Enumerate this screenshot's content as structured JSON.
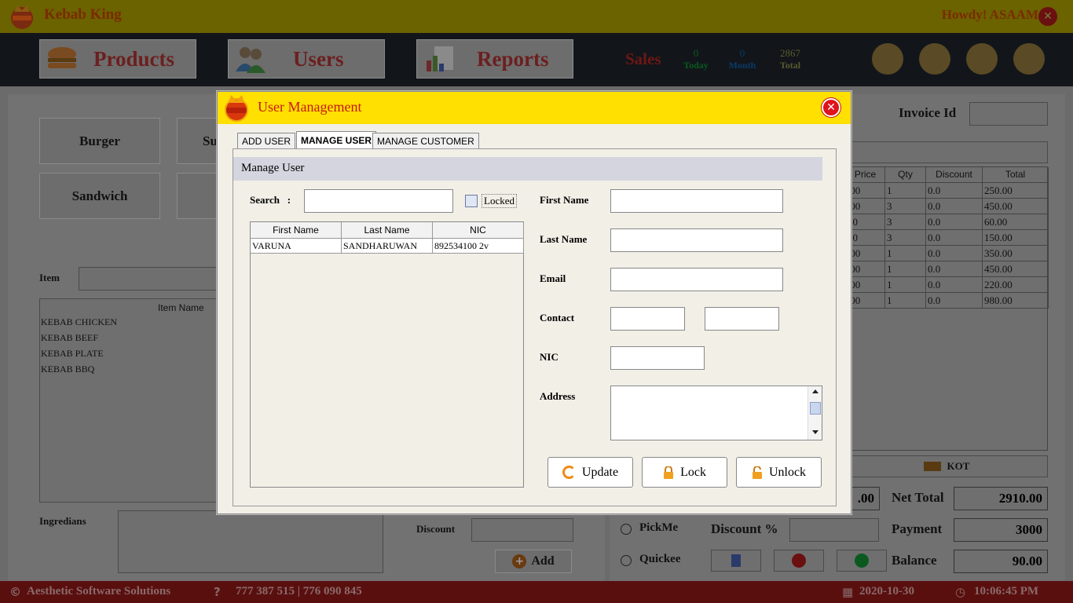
{
  "app": {
    "title": "Kebab King",
    "greeting": "Howdy! ASAAM"
  },
  "nav": {
    "products": "Products",
    "users": "Users",
    "reports": "Reports",
    "sales_label": "Sales",
    "stats": [
      {
        "value": "0",
        "label": "Today"
      },
      {
        "value": "0",
        "label": "Month"
      },
      {
        "value": "2867",
        "label": "Total"
      }
    ]
  },
  "categories": [
    "Burger",
    "Su",
    "Sandwich"
  ],
  "item_search": {
    "label": "Item",
    "value": ""
  },
  "item_table": {
    "header": "Item Name",
    "rows": [
      "KEBAB CHICKEN",
      "KEBAB BEEF",
      "KEBAB PLATE",
      "KEBAB BBQ"
    ]
  },
  "ingredients_label": "Ingredians",
  "discount_label": "Discount",
  "add_button": "Add",
  "invoice": {
    "label": "Invoice Id",
    "columns": [
      "Price",
      "Qty",
      "Discount",
      "Total"
    ],
    "rows": [
      [
        ".00",
        "1",
        "0.0",
        "250.00"
      ],
      [
        ".00",
        "3",
        "0.0",
        "450.00"
      ],
      [
        "00",
        "3",
        "0.0",
        "60.00"
      ],
      [
        "00",
        "3",
        "0.0",
        "150.00"
      ],
      [
        ".00",
        "1",
        "0.0",
        "350.00"
      ],
      [
        ".00",
        "1",
        "0.0",
        "450.00"
      ],
      [
        ".00",
        "1",
        "0.0",
        "220.00"
      ],
      [
        ".00",
        "1",
        "0.0",
        "980.00"
      ]
    ],
    "kot_label": "KOT",
    "partial_total": ".00",
    "net_total_label": "Net Total",
    "net_total": "2910.00",
    "payment_label": "Payment",
    "payment": "3000",
    "balance_label": "Balance",
    "balance": "90.00",
    "pickme_label": "PickMe",
    "quickee_label": "Quickee",
    "discount_pct_label": "Discount %"
  },
  "footer": {
    "company": "Aesthetic Software Solutions",
    "phone": "777 387 515 | 776 090 845",
    "date": "2020-10-30",
    "time": "10:06:45 PM"
  },
  "modal": {
    "title": "User Management",
    "tabs": [
      "ADD USER",
      "MANAGE USER",
      "MANAGE CUSTOMER"
    ],
    "section_title": "Manage User",
    "search_label": "Search   :",
    "search_value": "",
    "locked_label": "Locked",
    "locked_checked": false,
    "grid": {
      "columns": [
        "First Name",
        "Last Name",
        "NIC"
      ],
      "rows": [
        [
          "VARUNA",
          "SANDHARUWAN",
          "892534100 2v"
        ]
      ]
    },
    "fields": {
      "first_name": "First Name",
      "last_name": "Last Name",
      "email": "Email",
      "contact": "Contact",
      "nic": "NIC",
      "address": "Address"
    },
    "buttons": {
      "update": "Update",
      "lock": "Lock",
      "unlock": "Unlock"
    }
  },
  "colors": {
    "modal_header": "#ffe000",
    "close_red": "#e0121a",
    "title_red": "#c61a10"
  }
}
